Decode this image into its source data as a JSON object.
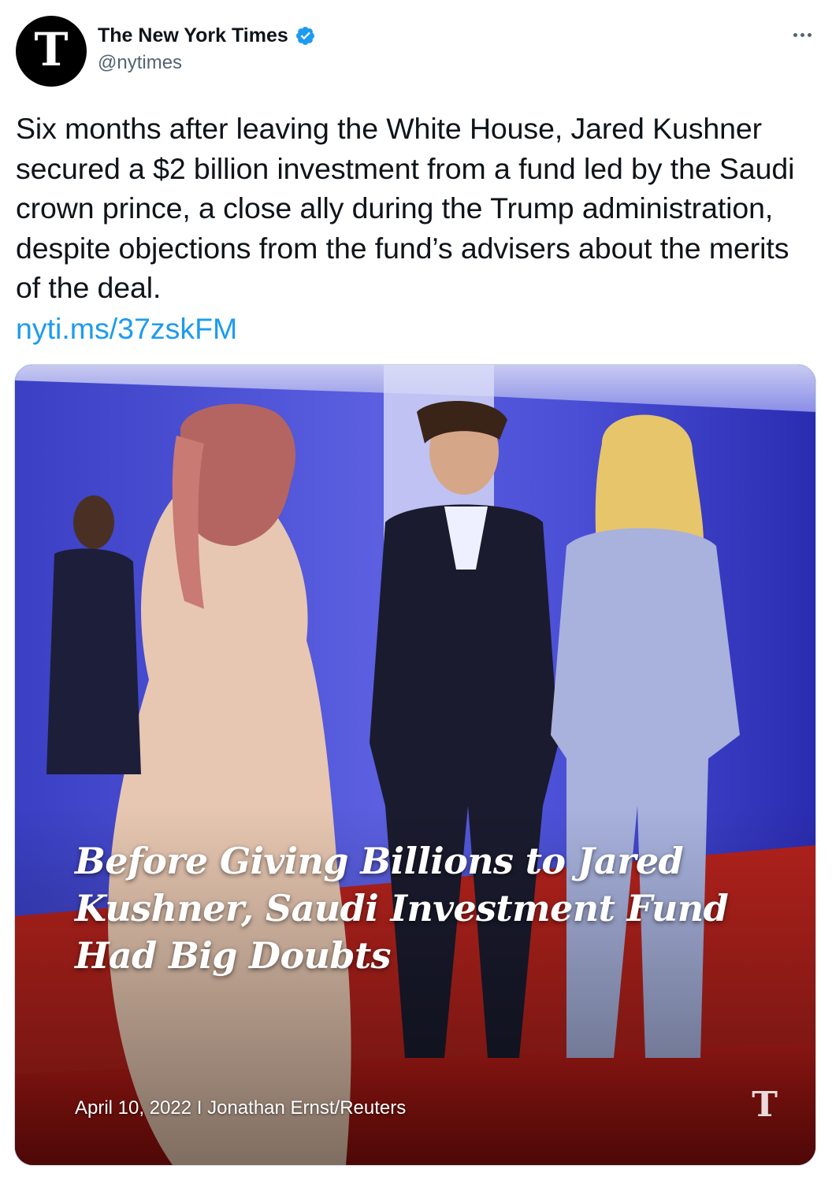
{
  "author": {
    "display_name": "The New York Times",
    "handle": "@nytimes",
    "avatar_glyph": "T",
    "verified": true,
    "verified_color": "#1d9bf0"
  },
  "menu": {
    "more_icon": "more-horizontal-icon"
  },
  "tweet": {
    "text": "Six months after leaving the White House, Jared Kushner secured a $2 billion investment from a fund led by the Saudi crown prince, a close ally during the Trump administration, despite objections from the fund’s advisers about the merits of the deal.",
    "link_text": "nyti.ms/37zskFM",
    "link_color": "#1d9bf0"
  },
  "media": {
    "headline": "Before Giving Billions to Jared Kushner, Saudi Investment Fund Had Big Doubts",
    "credit": "April 10, 2022 I Jonathan Ernst/Reuters",
    "logo_glyph": "T"
  }
}
